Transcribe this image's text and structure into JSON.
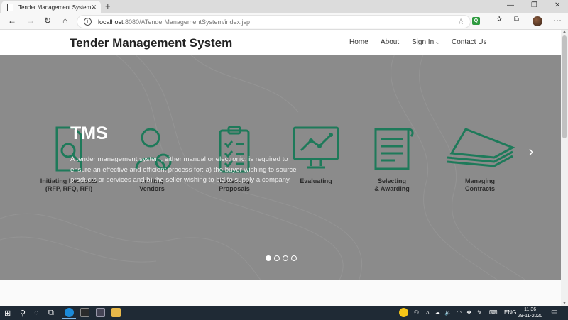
{
  "browser": {
    "tab_title": "Tender Management System",
    "url_host": "localhost",
    "url_path": ":8080/ATenderManagementSystem/index.jsp"
  },
  "site": {
    "brand": "Tender Management System",
    "nav": [
      "Home",
      "About",
      "Sign In",
      "Contact Us"
    ]
  },
  "hero": {
    "title": "TMS",
    "description": "A tender management system, either manual or electronic, is required to ensure an effective and efficient process for: a) the buyer wishing to source products or services and b) the seller wishing to bid to supply a company.",
    "steps": [
      {
        "label": "Initiating Requests\n(RFP, RFQ, RFI)",
        "icon": "document-search-icon"
      },
      {
        "label": "Inviting\nVendors",
        "icon": "people-icon"
      },
      {
        "label": "Collecting\nProposals",
        "icon": "clipboard-checklist-icon"
      },
      {
        "label": "Evaluating",
        "icon": "monitor-chart-icon"
      },
      {
        "label": "Selecting\n& Awarding",
        "icon": "scroll-icon"
      },
      {
        "label": "Managing\nContracts",
        "icon": "stacked-papers-icon"
      }
    ],
    "slide_count": 4,
    "active_slide": 1
  },
  "taskbar": {
    "lang": "ENG",
    "time": "11:36",
    "date": "29-11-2020"
  },
  "colors": {
    "icon_green": "#1e7a5a",
    "hero_overlay": "#8b8b8b",
    "taskbar": "#1f2a35"
  }
}
